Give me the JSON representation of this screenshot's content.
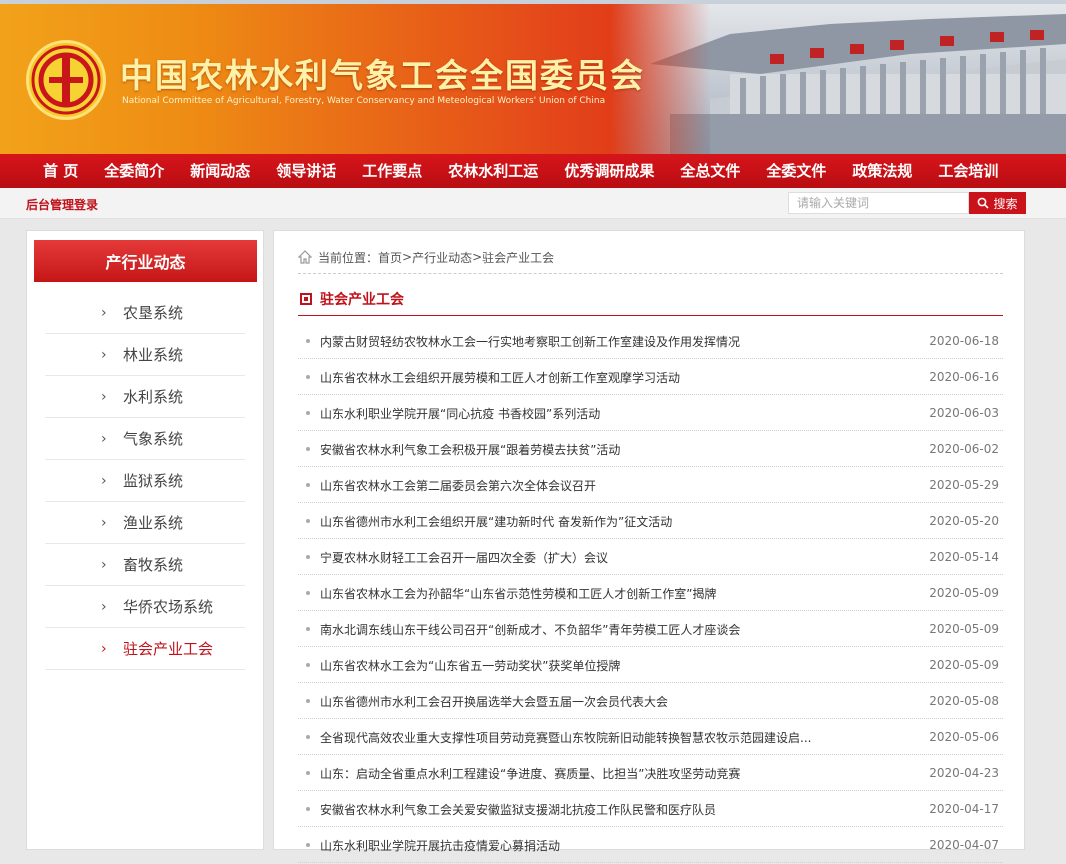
{
  "site": {
    "title": "中国农林水利气象工会全国委员会",
    "subtitle": "National Committee of Agricultural, Forestry, Water Conservancy and Meteological Workers' Union of China"
  },
  "nav": {
    "items": [
      "首 页",
      "全委简介",
      "新闻动态",
      "领导讲话",
      "工作要点",
      "农林水利工运",
      "优秀调研成果",
      "全总文件",
      "全委文件",
      "政策法规",
      "工会培训"
    ]
  },
  "util": {
    "admin_label": "后台管理登录",
    "search_placeholder": "请输入关键词",
    "search_value": "",
    "search_label": "搜索"
  },
  "sidebar": {
    "title": "产行业动态",
    "items": [
      "农垦系统",
      "林业系统",
      "水利系统",
      "气象系统",
      "监狱系统",
      "渔业系统",
      "畜牧系统",
      "华侨农场系统",
      "驻会产业工会"
    ],
    "active_index": 8
  },
  "breadcrumb": {
    "prefix": "当前位置：",
    "items": [
      "首页",
      "产行业动态",
      "驻会产业工会"
    ],
    "sep": ">"
  },
  "section": {
    "title": "驻会产业工会"
  },
  "articles": [
    {
      "title": "内蒙古财贸轻纺农牧林水工会一行实地考察职工创新工作室建设及作用发挥情况",
      "date": "2020-06-18"
    },
    {
      "title": "山东省农林水工会组织开展劳模和工匠人才创新工作室观摩学习活动",
      "date": "2020-06-16"
    },
    {
      "title": "山东水利职业学院开展“同心抗疫 书香校园”系列活动",
      "date": "2020-06-03"
    },
    {
      "title": "安徽省农林水利气象工会积极开展“跟着劳模去扶贫”活动",
      "date": "2020-06-02"
    },
    {
      "title": "山东省农林水工会第二届委员会第六次全体会议召开",
      "date": "2020-05-29"
    },
    {
      "title": "山东省德州市水利工会组织开展“建功新时代 奋发新作为”征文活动",
      "date": "2020-05-20"
    },
    {
      "title": "宁夏农林水财轻工工会召开一届四次全委（扩大）会议",
      "date": "2020-05-14"
    },
    {
      "title": "山东省农林水工会为孙韶华“山东省示范性劳模和工匠人才创新工作室”揭牌",
      "date": "2020-05-09"
    },
    {
      "title": "南水北调东线山东干线公司召开“创新成才、不负韶华”青年劳模工匠人才座谈会",
      "date": "2020-05-09"
    },
    {
      "title": "山东省农林水工会为“山东省五一劳动奖状”获奖单位授牌",
      "date": "2020-05-09"
    },
    {
      "title": "山东省德州市水利工会召开换届选举大会暨五届一次会员代表大会",
      "date": "2020-05-08"
    },
    {
      "title": "全省现代高效农业重大支撑性项目劳动竞赛暨山东牧院新旧动能转换智慧农牧示范园建设启...",
      "date": "2020-05-06"
    },
    {
      "title": "山东：启动全省重点水利工程建设“争进度、赛质量、比担当”决胜攻坚劳动竞赛",
      "date": "2020-04-23"
    },
    {
      "title": "安徽省农林水利气象工会关爱安徽监狱支援湖北抗疫工作队民警和医疗队员",
      "date": "2020-04-17"
    },
    {
      "title": "山东水利职业学院开展抗击疫情爱心募捐活动",
      "date": "2020-04-07"
    }
  ],
  "colors": {
    "brand_red": "#c0121a",
    "nav_red": "#c8121a",
    "banner_orange": "#f2a21a"
  },
  "icons": {
    "logo": "union-emblem-icon",
    "search": "search-icon",
    "home": "home-icon",
    "section": "square-bullet-icon",
    "chevron": "chevron-right-icon"
  }
}
